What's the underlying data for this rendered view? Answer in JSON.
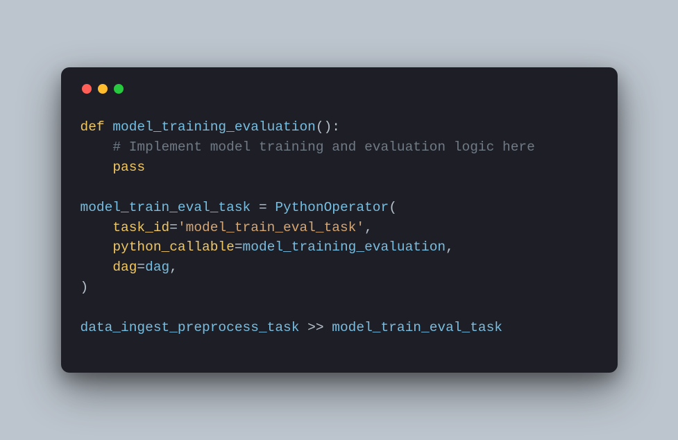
{
  "colors": {
    "background": "#bcc4cd",
    "window": "#1e1f26",
    "red": "#ff5f56",
    "yellow": "#ffbd2e",
    "green": "#27c93f",
    "keyword": "#f0c660",
    "identifier": "#77bde0",
    "string": "#d7a56f",
    "comment": "#6f7a85",
    "default": "#b7c2cc"
  },
  "code": {
    "line1": {
      "def": "def ",
      "fn": "model_training_evaluation",
      "rest": "():"
    },
    "line2": {
      "indent": "    ",
      "comment": "# Implement model training and evaluation logic here"
    },
    "line3": {
      "indent": "    ",
      "pass": "pass"
    },
    "line5": {
      "name": "model_train_eval_task",
      "eq": " = ",
      "cls": "PythonOperator",
      "open": "("
    },
    "line6": {
      "indent": "    ",
      "param": "task_id",
      "eq": "=",
      "str": "'model_train_eval_task'",
      "comma": ","
    },
    "line7": {
      "indent": "    ",
      "param": "python_callable",
      "eq": "=",
      "val": "model_training_evaluation",
      "comma": ","
    },
    "line8": {
      "indent": "    ",
      "param": "dag",
      "eq": "=",
      "val": "dag",
      "comma": ","
    },
    "line9": {
      "close": ")"
    },
    "line11": {
      "lhs": "data_ingest_preprocess_task",
      "op": " >> ",
      "rhs": "model_train_eval_task"
    }
  }
}
